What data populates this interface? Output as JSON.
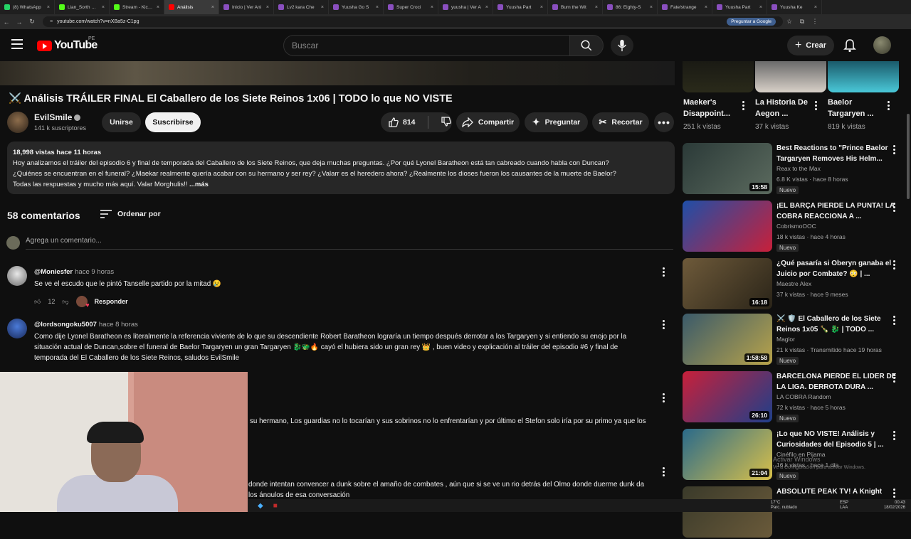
{
  "browser": {
    "tabs": [
      {
        "title": "(8) WhatsApp",
        "color": "#25d366"
      },
      {
        "title": "Lian_Sorth Stre",
        "color": "#53fc18"
      },
      {
        "title": "Stream - Kick P",
        "color": "#53fc18"
      },
      {
        "title": "Análisis",
        "color": "#ff0000",
        "active": true
      },
      {
        "title": "Inicio | Ver Ani",
        "color": "#8a4fbf"
      },
      {
        "title": "Lv2 kara Che",
        "color": "#8a4fbf"
      },
      {
        "title": "Yuusha Go S",
        "color": "#8a4fbf"
      },
      {
        "title": "Super Croci",
        "color": "#8a4fbf"
      },
      {
        "title": "yuusha | Ver A",
        "color": "#8a4fbf"
      },
      {
        "title": "Yuusha Part",
        "color": "#8a4fbf"
      },
      {
        "title": "Burn the Wit",
        "color": "#8a4fbf"
      },
      {
        "title": "86: Eighty-S",
        "color": "#8a4fbf"
      },
      {
        "title": "Fate/strange",
        "color": "#8a4fbf"
      },
      {
        "title": "Yuusha Part",
        "color": "#8a4fbf"
      },
      {
        "title": "Yuusha Ke",
        "color": "#8a4fbf"
      }
    ],
    "url": "youtube.com/watch?v=nXBa5z-C1pg",
    "google_button": "Preguntar a Google"
  },
  "header": {
    "logo_text": "YouTube",
    "country_code": "PE",
    "search_placeholder": "Buscar",
    "create_label": "Crear"
  },
  "video": {
    "title": "⚔️ Análisis TRÁILER FINAL El Caballero de los Siete Reinos 1x06 | TODO lo que NO VISTE",
    "channel_name": "EvilSmile",
    "subscribers": "141 k suscriptores",
    "join_label": "Unirse",
    "subscribe_label": "Suscribirse",
    "likes": "814",
    "share_label": "Compartir",
    "ask_label": "Preguntar",
    "clip_label": "Recortar"
  },
  "description": {
    "meta": "18,998 vistas  hace 11 horas",
    "line1": "Hoy analizamos el tráiler del episodio 6 y final de temporada del Caballero de los Siete Reinos, que deja muchas preguntas. ¿Por qué Lyonel Baratheon está tan cabreado cuando habla con Duncan?",
    "line2": "¿Quiénes se encuentran en el funeral? ¿Maekar realmente quería acabar con su hermano y ser rey? ¿Valarr es el heredero ahora? ¿Realmente los dioses fueron los causantes de la muerte de Baelor?",
    "line3": "Todas las respuestas y mucho más aquí. Valar Morghulis!!",
    "more": "...más"
  },
  "comments": {
    "count_label": "58 comentarios",
    "sort_label": "Ordenar por",
    "add_placeholder": "Agrega un comentario...",
    "items": [
      {
        "author": "@Moniesfer",
        "time": "hace 9 horas",
        "text": "Se ve el escudo que le pintó Tanselle partido por la mitad 😢",
        "likes": "12",
        "reply": "Responder"
      },
      {
        "author": "@lordsongoku5007",
        "time": "hace 8 horas",
        "line1": "Como dije Lyonel Baratheon es literalmente la referencia viviente de lo que su descendiente Robert Baratheon lograría un tiempo después derrotar a los Targaryen y si entiendo su enojo por la",
        "line2": "situación actual de Duncan,sobre el funeral de Baelor Targaryen un gran Targaryen 🐉🐲🔥 cayó el hubiera sido un gran rey 👑 , buen video y explicación al tráiler del episodio #6 y final de",
        "line3": "temporada del El Caballero de los Siete Reinos, saludos EvilSmile"
      },
      {
        "text": "su hermano, Los guardias no lo tocarían y sus sobrinos no lo enfrentarían y por último el Stefon solo iría por su primo ya que los"
      },
      {
        "line1": "donde intentan convencer a dunk sobre el amaño de combates , aún que si se ve un rio detrás del Olmo donde duerme dunk  da",
        "line2": "los ángulos de esa conversación"
      }
    ]
  },
  "sidebar": {
    "top_items": [
      {
        "title": "Maeker's Disappoint...",
        "views": "251 k vistas"
      },
      {
        "title": "La Historia De Aegon ...",
        "views": "37 k vistas"
      },
      {
        "title": "Baelor Targaryen ...",
        "views": "819 k vistas"
      }
    ],
    "recommendations": [
      {
        "title": "Best Reactions to \"Prince Baelor Targaryen Removes His Helm...",
        "channel": "Reax to the Max",
        "views": "6.8 K vistas · hace 8 horas",
        "badge": "Nuevo",
        "duration": "15:58",
        "thumb": [
          "#2b3a38",
          "#5b6a5e"
        ]
      },
      {
        "title": "¡EL BARÇA PIERDE LA PUNTA! LA COBRA REACCIONA A ...",
        "channel": "CobrismoOOC",
        "views": "18 k vistas · hace 4 horas",
        "badge": "Nuevo",
        "duration": "",
        "thumb": [
          "#1e4fa8",
          "#c8203a"
        ]
      },
      {
        "title": "¿Qué pasaría si Oberyn ganaba el Juicio por Combate? 😳 | ...",
        "channel": "Maestre Alex",
        "views": "37 k vistas · hace 9 meses",
        "badge": "",
        "duration": "16:18",
        "thumb": [
          "#6e5a3a",
          "#2a2418"
        ]
      },
      {
        "title": "⚔️ 🛡️ El Caballero de los Siete Reinos 1x05 🍾 🐉 | TODO ...",
        "channel": "Maglor",
        "views": "21 k vistas · Transmitido hace 19 horas",
        "badge": "Nuevo",
        "duration": "1:58:58",
        "thumb": [
          "#3a5a6a",
          "#b8a34a"
        ]
      },
      {
        "title": "BARCELONA PIERDE EL LIDER DE LA LIGA. DERROTA DURA ...",
        "channel": "LA COBRA Random",
        "views": "72 k vistas · hace 5 horas",
        "badge": "Nuevo",
        "duration": "26:10",
        "thumb": [
          "#c8203a",
          "#1e3f8a"
        ]
      },
      {
        "title": "¡Lo que NO VISTE! Análisis y Curiosidades del Episodio 5 | ...",
        "channel": "Cinéfilo en Pijama",
        "views": "16 k vistas · hace 1 día",
        "badge": "Nuevo",
        "duration": "21:04",
        "thumb": [
          "#2a6a8a",
          "#d8c04a"
        ]
      },
      {
        "title": "ABSOLUTE PEAK TV! A Knight",
        "channel": "",
        "views": "",
        "badge": "",
        "duration": "",
        "thumb": [
          "#3a3a2a",
          "#6a5a3a"
        ]
      }
    ]
  },
  "overlay": {
    "watermark_line1": "Activar Windows",
    "watermark_line2": "Ve a Configuración para activar Windows."
  },
  "taskbar": {
    "weather": "17°C",
    "weather_desc": "Parc. nublado",
    "lang": "ESP",
    "lang2": "LAA",
    "time": "00:43",
    "date": "18/02/2026"
  }
}
